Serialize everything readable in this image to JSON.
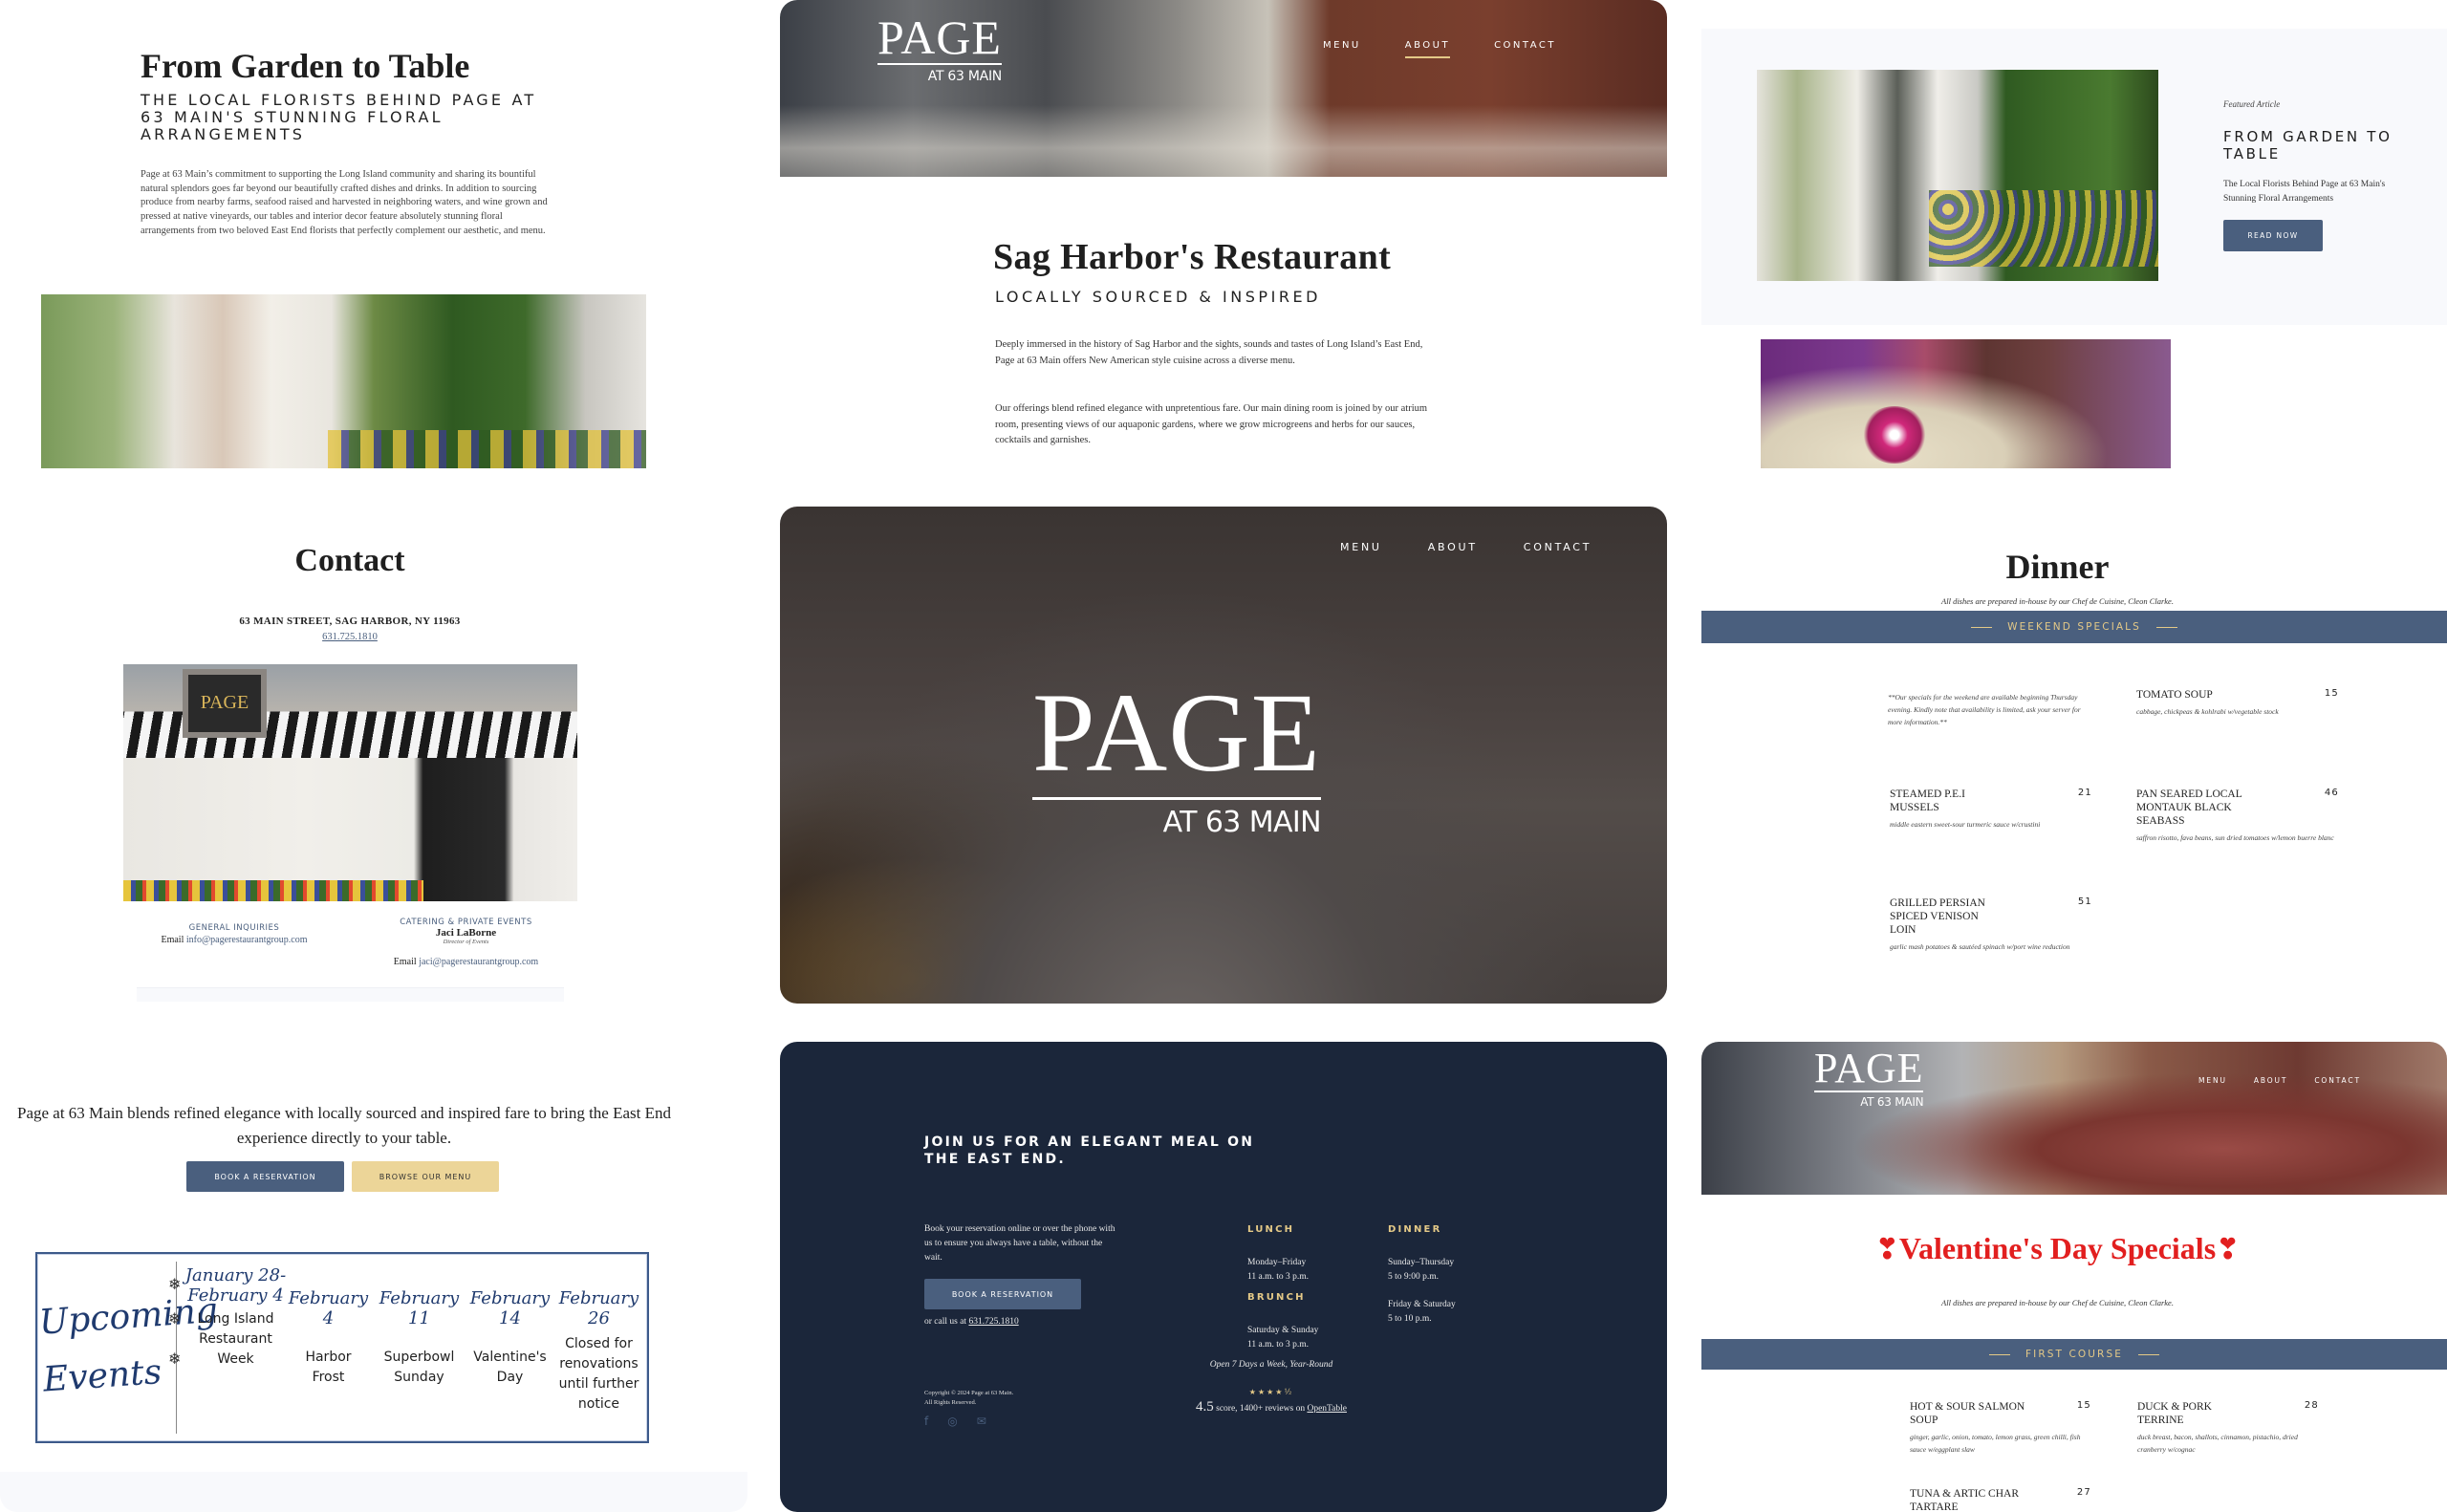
{
  "brand": {
    "logo_main": "PAGE",
    "logo_sub": "AT 63 MAIN",
    "colors": {
      "navy": "#4a5f7e",
      "dark_navy": "#1b263a",
      "gold": "#e4c987",
      "cream_button": "#ecd598",
      "valentine_red": "#e21f1f"
    }
  },
  "nav": {
    "items": [
      "MENU",
      "ABOUT",
      "CONTACT"
    ],
    "active": "ABOUT"
  },
  "article": {
    "title": "From Garden to Table",
    "subtitle": "THE LOCAL FLORISTS BEHIND PAGE AT 63 MAIN'S STUNNING FLORAL ARRANGEMENTS",
    "body": "Page at 63 Main’s commitment to supporting the Long Island community and sharing its bountiful natural splendors goes far beyond our beautifully crafted dishes and drinks. In addition to sourcing produce from nearby farms, seafood raised and harvested in neighboring waters, and wine grown and pressed at native vineyards, our tables and interior decor feature absolutely stunning floral arrangements from two beloved East End florists that perfectly complement our aesthetic, and menu.",
    "image_alt": "flower-box-storefront-photo"
  },
  "about": {
    "title": "Sag Harbor's Restaurant",
    "subtitle": "LOCALLY SOURCED & INSPIRED",
    "paragraph_1": "Deeply immersed in the history of Sag Harbor and the sights, sounds and tastes of Long Island’s East End, Page at 63 Main offers New American style cuisine across a diverse menu.",
    "paragraph_2": "Our offerings blend refined elegance with unpretentious fare. Our main dining room is joined by our atrium room, presenting views of our aquaponic gardens, where we grow microgreens and herbs for our sauces, cocktails and garnishes."
  },
  "featured": {
    "kicker": "Featured Article",
    "title": "FROM GARDEN TO TABLE",
    "description": "The Local Florists Behind Page at 63 Main's Stunning Floral Arrangements",
    "button": "READ NOW"
  },
  "contact": {
    "title": "Contact",
    "address": "63 MAIN STREET, SAG HARBOR, NY 11963",
    "phone": "631.725.1810",
    "storefront_sign": "PAGE",
    "general": {
      "label": "GENERAL INQUIRIES",
      "email_prefix": "Email ",
      "email": "info@pagerestaurantgroup.com"
    },
    "catering": {
      "label": "CATERING & PRIVATE EVENTS",
      "name": "Jaci LaBorne",
      "role": "Director of Events",
      "email_prefix": "Email ",
      "email": "jaci@pagerestaurantgroup.com"
    }
  },
  "dinner": {
    "title": "Dinner",
    "note": "All dishes are prepared in-house by our Chef de Cuisine, Cleon Clarke.",
    "section": "WEEKEND SPECIALS",
    "intro": "**Our specials for the weekend are available beginning Thursday evening. Kindly note that availability is limited, ask your server for more information.**",
    "items": [
      {
        "name": "TOMATO SOUP",
        "price": "15",
        "desc": "cabbage, chickpeas & kohlrabi w/vegetable stock"
      },
      {
        "name": "STEAMED P.E.I MUSSELS",
        "price": "21",
        "desc": "middle eastern sweet-sour turmeric sauce w/crustini"
      },
      {
        "name": "PAN SEARED LOCAL MONTAUK BLACK SEABASS",
        "price": "46",
        "desc": "saffron risotto, fava beans, sun dried tomatoes w/lemon buerre blanc"
      },
      {
        "name": "GRILLED PERSIAN SPICED VENISON LOIN",
        "price": "51",
        "desc": "garlic mash potatoes & sautéed spinach w/port wine reduction"
      }
    ]
  },
  "home": {
    "lead": "Page at 63 Main blends refined elegance with locally sourced and inspired fare to bring the East End experience directly to your table.",
    "book_button": "BOOK A RESERVATION",
    "menu_button": "BROWSE OUR MENU",
    "events": {
      "title": "Upcoming Events",
      "list": [
        {
          "date": "January 28- February 4",
          "name": "Long Island Restaurant Week"
        },
        {
          "date": "February 4",
          "name": "Harbor Frost"
        },
        {
          "date": "February 11",
          "name": "Superbowl Sunday"
        },
        {
          "date": "February 14",
          "name": "Valentine's Day"
        },
        {
          "date": "February 26",
          "name": "Closed for renovations until further notice"
        }
      ]
    }
  },
  "footer": {
    "heading": "JOIN US FOR AN ELEGANT MEAL ON THE EAST END.",
    "text": "Book your reservation online or over the phone with us to ensure you always have a table, without the wait.",
    "button": "BOOK A RESERVATION",
    "call_prefix": "or call us at ",
    "phone": "631.725.1810",
    "hours": {
      "lunch_label": "LUNCH",
      "lunch_days": "Monday–Friday",
      "lunch_time": "11 a.m. to 3 p.m.",
      "brunch_label": "BRUNCH",
      "brunch_days": "Saturday & Sunday",
      "brunch_time": "11 a.m. to 3 p.m.",
      "dinner_label": "DINNER",
      "dinner_days_1": "Sunday–Thursday",
      "dinner_time_1": "5 to 9:00 p.m.",
      "dinner_days_2": "Friday & Saturday",
      "dinner_time_2": "5 to 10 p.m."
    },
    "open": "Open 7 Days a Week, Year-Round",
    "rating": {
      "stars": "★★★★½",
      "value": "4.5",
      "text": " score, 1400+ reviews on ",
      "link": "OpenTable"
    },
    "copyright_1": "Copyright © 2024 Page at 63 Main.",
    "copyright_2": "All Rights Reserved.",
    "social": [
      "facebook-icon",
      "instagram-icon",
      "email-icon"
    ]
  },
  "valentine": {
    "title": "Valentine's Day Specials",
    "note": "All dishes are prepared in-house by our Chef de Cuisine, Cleon Clarke.",
    "section": "FIRST COURSE",
    "items": [
      {
        "name": "HOT & SOUR SALMON SOUP",
        "price": "15",
        "desc": "ginger, garlic, onion, tomato, lemon grass, green chilli, fish sauce w/eggplant slaw"
      },
      {
        "name": "DUCK & PORK TERRINE",
        "price": "28",
        "desc": "duck breast, bacon, shallots, cinnamon, pistachio, dried cranberry w/cognac"
      },
      {
        "name": "TUNA & ARTIC CHAR TARTARE",
        "price": "27",
        "desc": ""
      }
    ]
  }
}
